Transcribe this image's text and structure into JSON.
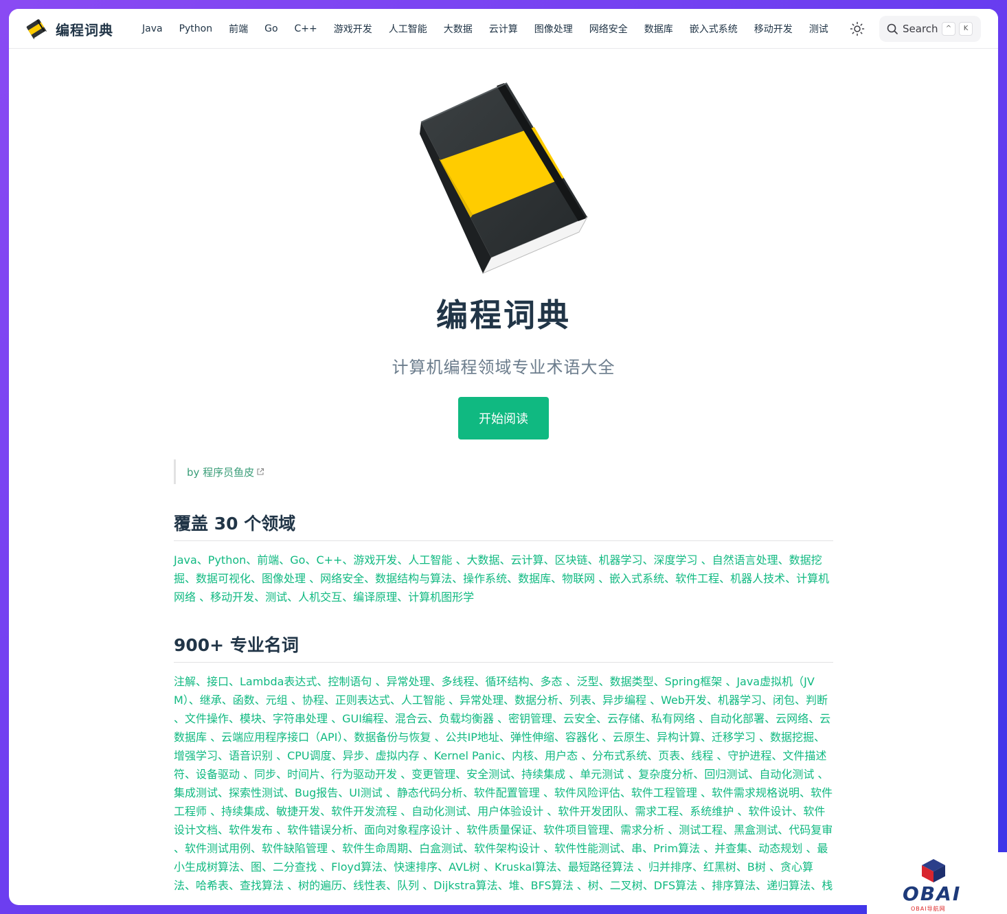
{
  "app": {
    "title": "编程词典"
  },
  "nav": {
    "items": [
      "Java",
      "Python",
      "前端",
      "Go",
      "C++",
      "游戏开发",
      "人工智能",
      "大数据",
      "云计算",
      "图像处理",
      "网络安全",
      "数据库",
      "嵌入式系统",
      "移动开发",
      "测试"
    ]
  },
  "search": {
    "label": "Search",
    "key1": "^",
    "key2": "K"
  },
  "hero": {
    "title": "编程词典",
    "tagline": "计算机编程领域专业术语大全",
    "cta": "开始阅读"
  },
  "author": {
    "text": "by 程序员鱼皮"
  },
  "sections": [
    {
      "heading": "覆盖 30 个领域",
      "text": "Java、Python、前端、Go、C++、游戏开发、人工智能 、大数据、云计算、区块链、机器学习、深度学习 、自然语言处理、数据挖掘、数据可视化、图像处理 、网络安全、数据结构与算法、操作系统、数据库、物联网 、嵌入式系统、软件工程、机器人技术、计算机网络 、移动开发、测试、人机交互、编译原理、计算机图形学"
    },
    {
      "heading": "900+ 专业名词",
      "text": "注解、接口、Lambda表达式、控制语句 、异常处理、多线程、循环结构、多态 、泛型、数据类型、Spring框架 、Java虚拟机（JVM）、继承、函数、元组 、协程、正则表达式、人工智能 、异常处理、数据分析、列表、异步编程 、Web开发、机器学习、闭包、判断 、文件操作、模块、字符串处理 、GUI编程、混合云、负载均衡器 、密钥管理、云安全、云存储、私有网络 、自动化部署、云网络、云数据库 、云端应用程序接口（API）、数据备份与恢复 、公共IP地址、弹性伸缩、容器化 、云原生、异构计算、迁移学习 、数据挖掘、增强学习、语音识别 、CPU调度、异步、虚拟内存 、Kernel Panic、内核、用户态 、分布式系统、页表、线程 、守护进程、文件描述符、设备驱动 、同步、时间片、行为驱动开发 、变更管理、安全测试、持续集成 、单元测试 、复杂度分析、回归测试、自动化测试 、集成测试、探索性测试、Bug报告、UI测试 、静态代码分析、软件配置管理 、软件风险评估、软件工程管理 、软件需求规格说明、软件工程师 、持续集成、敏捷开发、软件开发流程 、自动化测试、用户体验设计 、软件开发团队、需求工程、系统维护 、软件设计、软件设计文档、软件发布 、软件错误分析、面向对象程序设计 、软件质量保证、软件项目管理、需求分析 、测试工程、黑盒测试、代码复审 、软件测试用例、软件缺陷管理 、软件生命周期、白盒测试、软件架构设计 、软件性能测试、串、Prim算法 、并查集、动态规划 、最小生成树算法、图、二分查找 、Floyd算法、快速排序、AVL树 、Kruskal算法、最短路径算法 、归并排序、红黑树、B树 、贪心算法、哈希表、查找算法 、树的遍历、线性表、队列 、Dijkstra算法、堆、BFS算法 、树、二叉树、DFS算法 、排序算法、递归算法、栈"
    }
  ],
  "watermark": {
    "text": "OBAI",
    "sub": "OBAI导航网"
  },
  "colors": {
    "accent": "#10b981",
    "heading": "#213547",
    "tagline": "#6b7c8c",
    "book_yellow": "#ffcc00",
    "book_dark": "#2f3335"
  },
  "icons": {
    "theme": "sun-icon",
    "search": "search-icon",
    "external": "external-link-icon",
    "logo": "book-icon"
  }
}
